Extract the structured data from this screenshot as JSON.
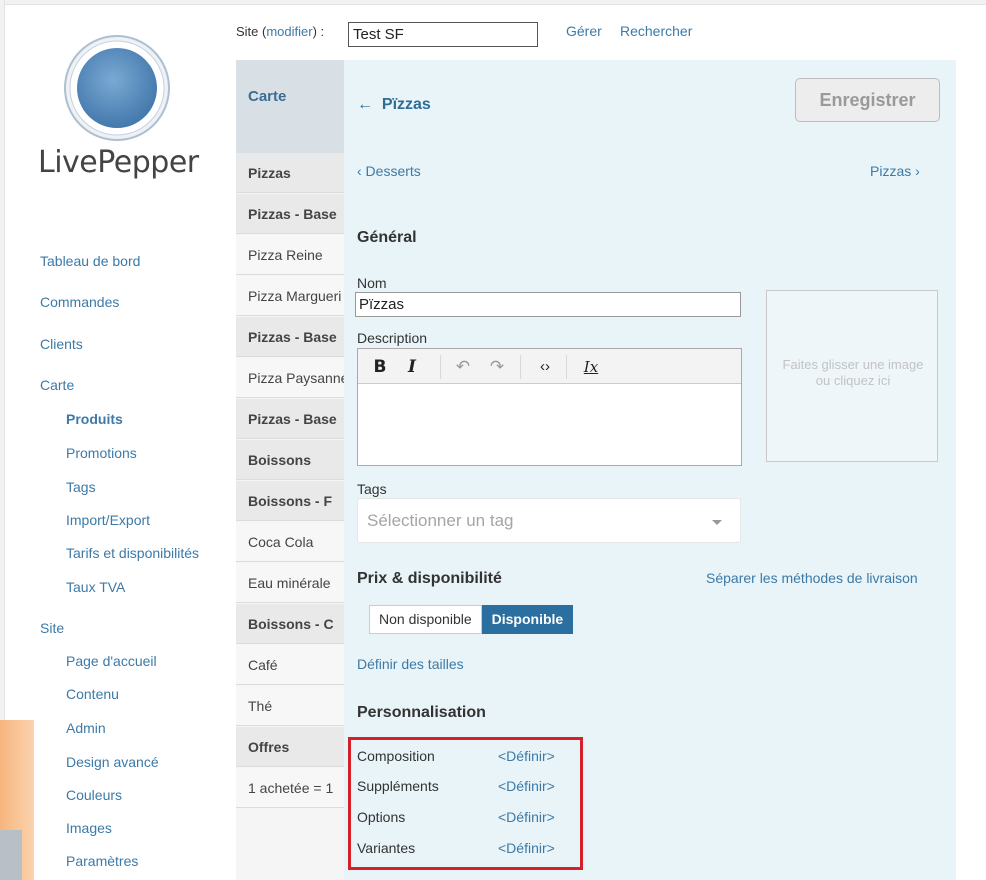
{
  "brand": {
    "name": "LivePepper"
  },
  "sidebar": {
    "items": [
      {
        "label": "Tableau de bord"
      },
      {
        "label": "Commandes"
      },
      {
        "label": "Clients"
      },
      {
        "label": "Carte"
      },
      {
        "label": "Produits"
      },
      {
        "label": "Promotions"
      },
      {
        "label": "Tags"
      },
      {
        "label": "Import/Export"
      },
      {
        "label": "Tarifs et disponibilités"
      },
      {
        "label": "Taux TVA"
      },
      {
        "label": "Site"
      },
      {
        "label": "Page d'accueil"
      },
      {
        "label": "Contenu"
      },
      {
        "label": "Admin"
      },
      {
        "label": "Design avancé"
      },
      {
        "label": "Couleurs"
      },
      {
        "label": "Images"
      },
      {
        "label": "Paramètres"
      }
    ]
  },
  "topbar": {
    "site_prefix": "Site (",
    "site_modifier": "modifier",
    "site_suffix": ") :",
    "site_value": "Test SF",
    "manage": "Gérer",
    "search": "Rechercher"
  },
  "products": {
    "header": "Carte",
    "rows": [
      {
        "label": "Pizzas"
      },
      {
        "label": "Pizzas - Base"
      },
      {
        "label": "Pizza Reine"
      },
      {
        "label": "Pizza Margueri"
      },
      {
        "label": "Pizzas - Base"
      },
      {
        "label": "Pizza Paysanne"
      },
      {
        "label": "Pizzas - Base"
      },
      {
        "label": "Boissons"
      },
      {
        "label": "Boissons - F"
      },
      {
        "label": "Coca Cola"
      },
      {
        "label": "Eau minérale"
      },
      {
        "label": "Boissons - C"
      },
      {
        "label": "Café"
      },
      {
        "label": "Thé"
      },
      {
        "label": "Offres"
      },
      {
        "label": "1 achetée = 1"
      }
    ]
  },
  "editor": {
    "back_arrow": "←",
    "title": "Pïzzas",
    "save": "Enregistrer",
    "prev": "‹ Desserts",
    "next": "Pizzas ›",
    "general_title": "Général",
    "name_label": "Nom",
    "name_value": "Pïzzas",
    "description_label": "Description",
    "toolbar": {
      "bold": "B",
      "italic": "I",
      "undo": "↶",
      "redo": "↷",
      "code": "‹›",
      "clear": "Ix"
    },
    "dropzone_text": "Faites glisser une image ou cliquez ici",
    "tags_label": "Tags",
    "tags_placeholder": "Sélectionner un tag",
    "price_title": "Prix & disponibilité",
    "separate_link": "Séparer les méthodes de livraison",
    "availability": {
      "off": "Non disponible",
      "on": "Disponible",
      "selected": "Disponible"
    },
    "sizes_link": "Définir des tailles",
    "custom_title": "Personnalisation",
    "custom_rows": [
      {
        "label": "Composition",
        "action": "<Définir>"
      },
      {
        "label": "Suppléments",
        "action": "<Définir>"
      },
      {
        "label": "Options",
        "action": "<Définir>"
      },
      {
        "label": "Variantes",
        "action": "<Définir>"
      }
    ]
  },
  "colors": {
    "link": "#3c7aa7",
    "panel_bg": "#e8f4f8",
    "toggle_active": "#2a6fa0",
    "highlight": "#d42028"
  }
}
